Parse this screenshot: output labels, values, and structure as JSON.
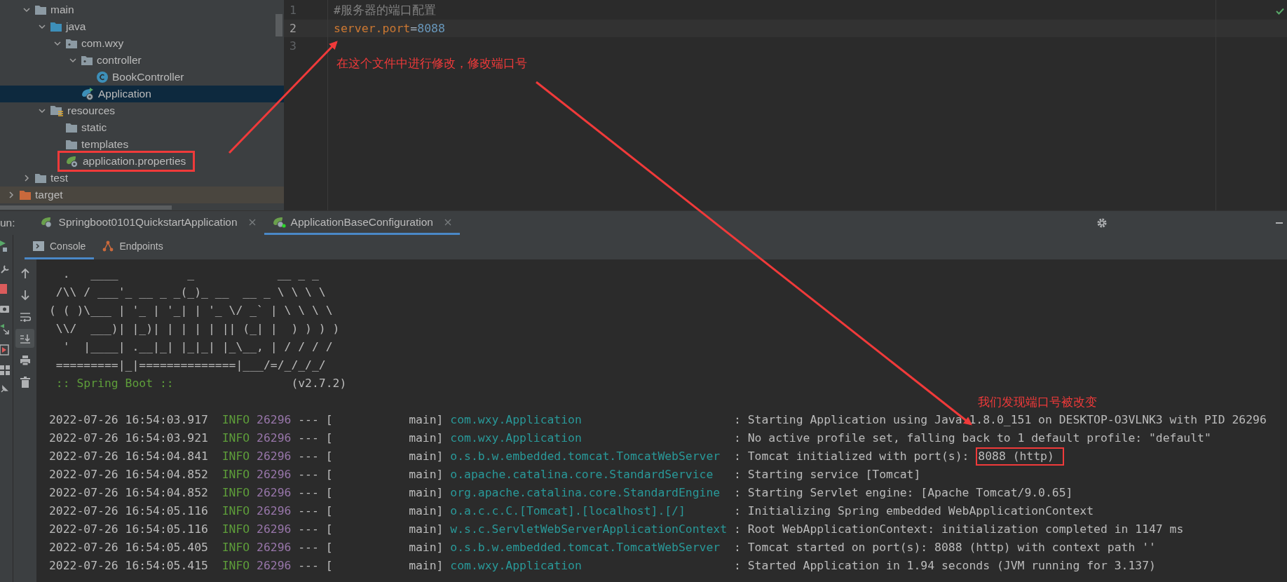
{
  "project_tree": {
    "items": [
      {
        "label": "main",
        "kind": "folder",
        "expanded": true,
        "selected": false,
        "highlighted": false,
        "children": [
          {
            "label": "java",
            "kind": "source-folder",
            "expanded": true,
            "selected": false,
            "highlighted": false,
            "children": [
              {
                "label": "com.wxy",
                "kind": "package",
                "expanded": true,
                "selected": false,
                "highlighted": false,
                "children": [
                  {
                    "label": "controller",
                    "kind": "package",
                    "expanded": true,
                    "selected": false,
                    "highlighted": false,
                    "children": [
                      {
                        "label": "BookController",
                        "kind": "class",
                        "selected": false,
                        "highlighted": false
                      }
                    ]
                  },
                  {
                    "label": "Application",
                    "kind": "spring-app",
                    "selected": true,
                    "highlighted": false
                  }
                ]
              }
            ]
          },
          {
            "label": "resources",
            "kind": "resources-folder",
            "expanded": true,
            "selected": false,
            "highlighted": false,
            "children": [
              {
                "label": "static",
                "kind": "folder",
                "selected": false,
                "highlighted": false
              },
              {
                "label": "templates",
                "kind": "folder",
                "selected": false,
                "highlighted": false
              },
              {
                "label": "application.properties",
                "kind": "spring-properties",
                "selected": false,
                "highlighted": true
              }
            ]
          }
        ]
      },
      {
        "label": "test",
        "kind": "folder",
        "expanded": false,
        "selected": false,
        "highlighted": false
      }
    ],
    "outer_items": [
      {
        "label": "target",
        "kind": "excluded-folder",
        "expanded": false,
        "selected": false,
        "highlighted": false
      }
    ]
  },
  "editor": {
    "lines": [
      {
        "number": "1",
        "current": false,
        "segments": [
          {
            "kind": "comment",
            "text": "#服务器的端口配置"
          }
        ]
      },
      {
        "number": "2",
        "current": true,
        "segments": [
          {
            "kind": "key",
            "text": "server.port"
          },
          {
            "kind": "operator",
            "text": "="
          },
          {
            "kind": "value",
            "text": "8088"
          }
        ]
      },
      {
        "number": "3",
        "current": false
      }
    ],
    "annotation": "在这个文件中进行修改，修改端口号"
  },
  "run_panel": {
    "label": "un:",
    "tabs": [
      {
        "label": "Springboot0101QuickstartApplication",
        "selected": false,
        "running": false
      },
      {
        "label": "ApplicationBaseConfiguration",
        "selected": true,
        "running": true
      }
    ],
    "sub_tabs": [
      {
        "label": "Console",
        "kind": "console",
        "selected": true
      },
      {
        "label": "Endpoints",
        "kind": "endpoints",
        "selected": false
      }
    ],
    "toolbar": [
      {
        "kind": "up",
        "on": false
      },
      {
        "kind": "down",
        "on": false
      },
      {
        "kind": "wrap",
        "on": false
      },
      {
        "kind": "scroll-end",
        "on": true
      },
      {
        "kind": "print",
        "on": false
      },
      {
        "kind": "trash",
        "on": false
      }
    ],
    "console": {
      "banner": [
        "  .   ____          _            __ _ _",
        " /\\\\ / ___'_ __ _ _(_)_ __  __ _ \\ \\ \\ \\",
        "( ( )\\___ | '_ | '_| | '_ \\/ _` | \\ \\ \\ \\",
        " \\\\/  ___)| |_)| | | | | || (_| |  ) ) ) )",
        "  '  |____| .__|_| |_|_| |_\\__, | / / / /",
        " =========|_|==============|___/=/_/_/_/"
      ],
      "spring_label": " :: Spring Boot ::",
      "version": "(v2.7.2)",
      "annotation": "我们发现端口号被改变",
      "rows": [
        {
          "timestamp": "2022-07-26 16:54:03.917",
          "level": "INFO",
          "pid": "26296",
          "separator": "---",
          "thread": "[           main]",
          "logger": "com.wxy.Application",
          "message": ": Starting Application using Java 1.8.0_151 on DESKTOP-O3VLNK3 with PID 26296"
        },
        {
          "timestamp": "2022-07-26 16:54:03.921",
          "level": "INFO",
          "pid": "26296",
          "separator": "---",
          "thread": "[           main]",
          "logger": "com.wxy.Application",
          "message": ": No active profile set, falling back to 1 default profile: \"default\""
        },
        {
          "timestamp": "2022-07-26 16:54:04.841",
          "level": "INFO",
          "pid": "26296",
          "separator": "---",
          "thread": "[           main]",
          "logger": "o.s.b.w.embedded.tomcat.TomcatWebServer",
          "message": ": Tomcat initialized with port(s):",
          "highlight": "8088 (http)"
        },
        {
          "timestamp": "2022-07-26 16:54:04.852",
          "level": "INFO",
          "pid": "26296",
          "separator": "---",
          "thread": "[           main]",
          "logger": "o.apache.catalina.core.StandardService",
          "message": ": Starting service [Tomcat]"
        },
        {
          "timestamp": "2022-07-26 16:54:04.852",
          "level": "INFO",
          "pid": "26296",
          "separator": "---",
          "thread": "[           main]",
          "logger": "org.apache.catalina.core.StandardEngine",
          "message": ": Starting Servlet engine: [Apache Tomcat/9.0.65]"
        },
        {
          "timestamp": "2022-07-26 16:54:05.116",
          "level": "INFO",
          "pid": "26296",
          "separator": "---",
          "thread": "[           main]",
          "logger": "o.a.c.c.C.[Tomcat].[localhost].[/]",
          "message": ": Initializing Spring embedded WebApplicationContext"
        },
        {
          "timestamp": "2022-07-26 16:54:05.116",
          "level": "INFO",
          "pid": "26296",
          "separator": "---",
          "thread": "[           main]",
          "logger": "w.s.c.ServletWebServerApplicationContext",
          "message": ": Root WebApplicationContext: initialization completed in 1147 ms"
        },
        {
          "timestamp": "2022-07-26 16:54:05.405",
          "level": "INFO",
          "pid": "26296",
          "separator": "---",
          "thread": "[           main]",
          "logger": "o.s.b.w.embedded.tomcat.TomcatWebServer",
          "message": ": Tomcat started on port(s): 8088 (http) with context path ''"
        },
        {
          "timestamp": "2022-07-26 16:54:05.415",
          "level": "INFO",
          "pid": "26296",
          "separator": "---",
          "thread": "[           main]",
          "logger": "com.wxy.Application",
          "message": ": Started Application in 1.94 seconds (JVM running for 3.137)"
        }
      ]
    }
  }
}
